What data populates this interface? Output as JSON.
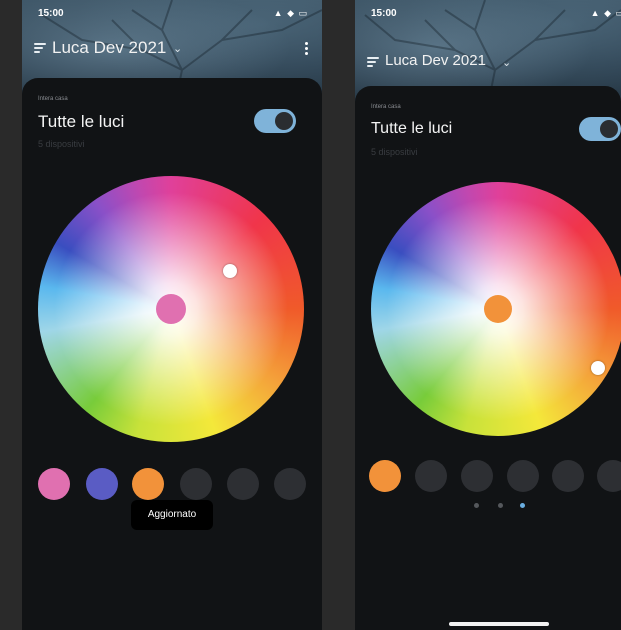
{
  "screens": [
    {
      "status": {
        "time": "15:00",
        "icons": "▲ ◆ ▭"
      },
      "home_title": "Luca Dev 2021",
      "group": {
        "eyebrow": "Intera casa",
        "title": "Tutte le luci",
        "subtitle": "5 dispositivi",
        "toggle_on": true
      },
      "wheel": {
        "selected_color": "#e070b0",
        "handle_color": "#ffffff"
      },
      "swatches": [
        "#e070b0",
        "#5a5cc4",
        "#f2923a",
        "#2d2f33",
        "#2d2f33",
        "#2d2f33"
      ],
      "pages": {
        "count": 3,
        "active": 2
      },
      "toast": "Aggiornato"
    },
    {
      "status": {
        "time": "15:00",
        "icons": "▲ ◆ ▭"
      },
      "home_title": "Luca Dev 2021",
      "group": {
        "eyebrow": "Intera casa",
        "title": "Tutte le luci",
        "subtitle": "5 dispositivi",
        "toggle_on": true
      },
      "wheel": {
        "selected_color": "#f2923a",
        "handle_color": "#ffffff"
      },
      "swatches": [
        "#f2923a",
        "#2d2f33",
        "#2d2f33",
        "#2d2f33",
        "#2d2f33",
        "#2d2f33"
      ],
      "pages": {
        "count": 3,
        "active": 2
      }
    }
  ],
  "colors": {
    "accent": "#7fb3d9",
    "sheet_bg": "#111315",
    "page_bg": "#2a2a2a"
  }
}
